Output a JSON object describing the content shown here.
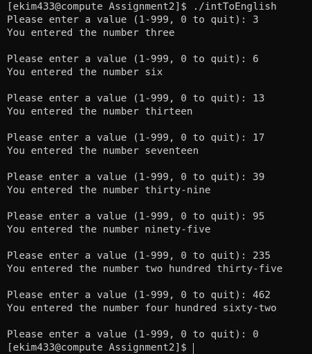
{
  "terminal": {
    "prompt_top": "[ekim433@compute Assignment2]$ ./intToEnglish",
    "entries": [
      {
        "prompt": "Please enter a value (1-999, 0 to quit): 3",
        "result": "You entered the number three"
      },
      {
        "prompt": "Please enter a value (1-999, 0 to quit): 6",
        "result": "You entered the number six"
      },
      {
        "prompt": "Please enter a value (1-999, 0 to quit): 13",
        "result": "You entered the number thirteen"
      },
      {
        "prompt": "Please enter a value (1-999, 0 to quit): 17",
        "result": "You entered the number seventeen"
      },
      {
        "prompt": "Please enter a value (1-999, 0 to quit): 39",
        "result": "You entered the number thirty-nine"
      },
      {
        "prompt": "Please enter a value (1-999, 0 to quit): 95",
        "result": "You entered the number ninety-five"
      },
      {
        "prompt": "Please enter a value (1-999, 0 to quit): 235",
        "result": "You entered the number two hundred thirty-five"
      },
      {
        "prompt": "Please enter a value (1-999, 0 to quit): 462",
        "result": "You entered the number four hundred sixty-two"
      }
    ],
    "final_prompt": "Please enter a value (1-999, 0 to quit): 0",
    "prompt_bottom": "[ekim433@compute Assignment2]$"
  },
  "colors": {
    "background": "#0c0c0c",
    "text": "#cccccc"
  }
}
